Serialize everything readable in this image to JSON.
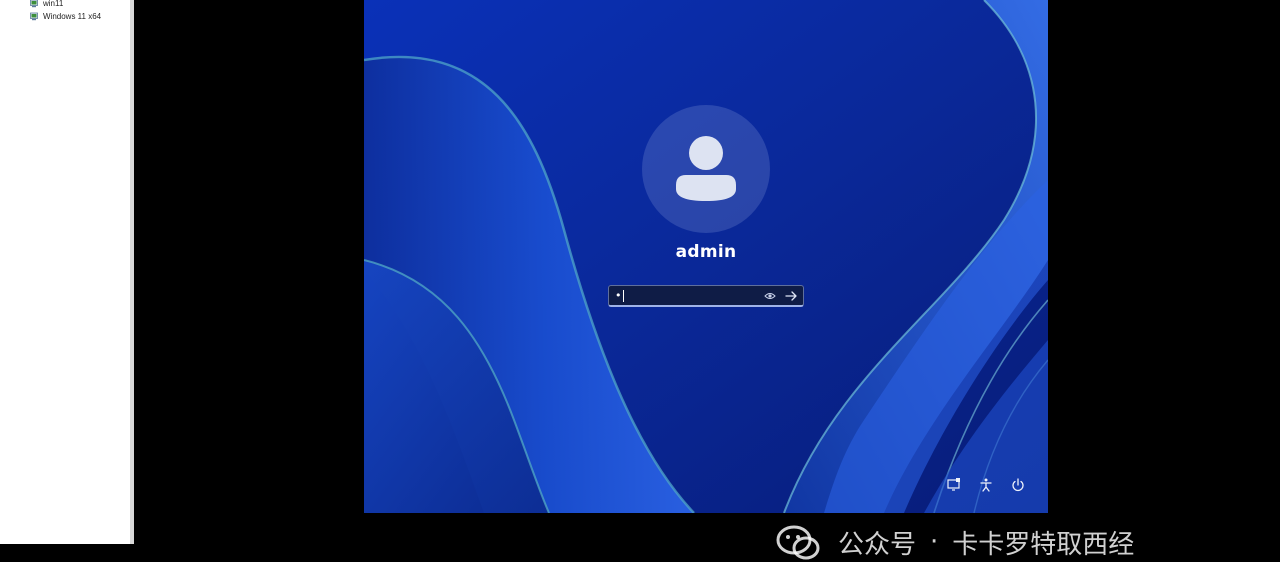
{
  "sidebar": {
    "items": [
      {
        "label": "win11"
      },
      {
        "label": "Windows 11 x64"
      }
    ]
  },
  "lock_screen": {
    "username": "admin",
    "password_value": "•",
    "icons": {
      "avatar": "user-avatar-icon",
      "reveal": "eye-icon",
      "submit": "arrow-right-icon",
      "network": "network-icon",
      "accessibility": "accessibility-icon",
      "power": "power-icon"
    },
    "colors": {
      "background": "#0a2a9e",
      "ribbon": "#1a4fd8",
      "text": "#ffffff"
    }
  },
  "watermark": {
    "prefix": "公众号",
    "separator": "·",
    "name": "卡卡罗特取西经"
  }
}
